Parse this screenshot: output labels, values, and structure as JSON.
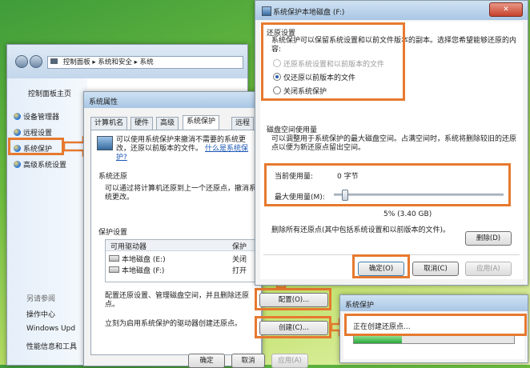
{
  "explorer": {
    "nav_path": [
      "控制面板",
      "系统和安全",
      "系统"
    ],
    "sidebar_title": "控制面板主页",
    "sidebar_items": [
      "设备管理器",
      "远程设置",
      "系统保护",
      "高级系统设置"
    ],
    "see_also": "另请参阅",
    "see_also_items": [
      "操作中心",
      "Windows Upd",
      "性能信息和工具"
    ]
  },
  "sysprops": {
    "title": "系统属性",
    "tabs": [
      "计算机名",
      "硬件",
      "高级",
      "系统保护",
      "远程"
    ],
    "intro": "可以使用系统保护来撤消不需要的系统更改，还原以前版本的文件。",
    "intro_link": "什么是系统保护?",
    "restore_section": "系统还原",
    "restore_desc": "可以通过将计算机还原到上一个还原点，撤消系统更改。",
    "protection_section": "保护设置",
    "table_headers": [
      "可用驱动器",
      "保护"
    ],
    "drives": [
      {
        "name": "本地磁盘 (E:)",
        "status": "关闭"
      },
      {
        "name": "本地磁盘 (F:)",
        "status": "打开"
      }
    ],
    "config_desc": "配置还原设置、管理磁盘空间，并且删除还原点。",
    "config_button": "配置(O)...",
    "create_desc": "立刻为启用系统保护的驱动器创建还原点。",
    "create_button": "创建(C)...",
    "ok": "确定",
    "cancel": "取消",
    "apply": "应用(A)"
  },
  "local_disk": {
    "title": "系统保护本地磁盘 (F:)",
    "restore_settings": "还原设置",
    "restore_desc": "系统保护可以保留系统设置和以前文件版本的副本。选择您希望能够还原的内容:",
    "options": [
      "还原系统设置和以前版本的文件",
      "仅还原以前版本的文件",
      "关闭系统保护"
    ],
    "selected_option": 1,
    "disk_usage": "磁盘空间使用量",
    "disk_desc": "可以调整用于系统保护的最大磁盘空间。占满空间时，系统将删除较旧的还原点以便为新还原点留出空间。",
    "current_usage_label": "当前使用量:",
    "current_usage_value": "0 字节",
    "max_usage_label": "最大使用量(M):",
    "max_usage_fraction": 0.05,
    "max_usage_value": "5% (3.40 GB)",
    "delete_desc": "删除所有还原点(其中包括系统设置和以前版本的文件)。",
    "delete_button": "删除(D)",
    "ok": "确定(O)",
    "cancel": "取消(C)",
    "apply": "应用(A)"
  },
  "creating": {
    "title": "系统保护",
    "message": "正在创建还原点...",
    "progress_fraction": 0.3
  },
  "colors": {
    "highlight": "#e6792f",
    "progress": "#37c24a"
  }
}
